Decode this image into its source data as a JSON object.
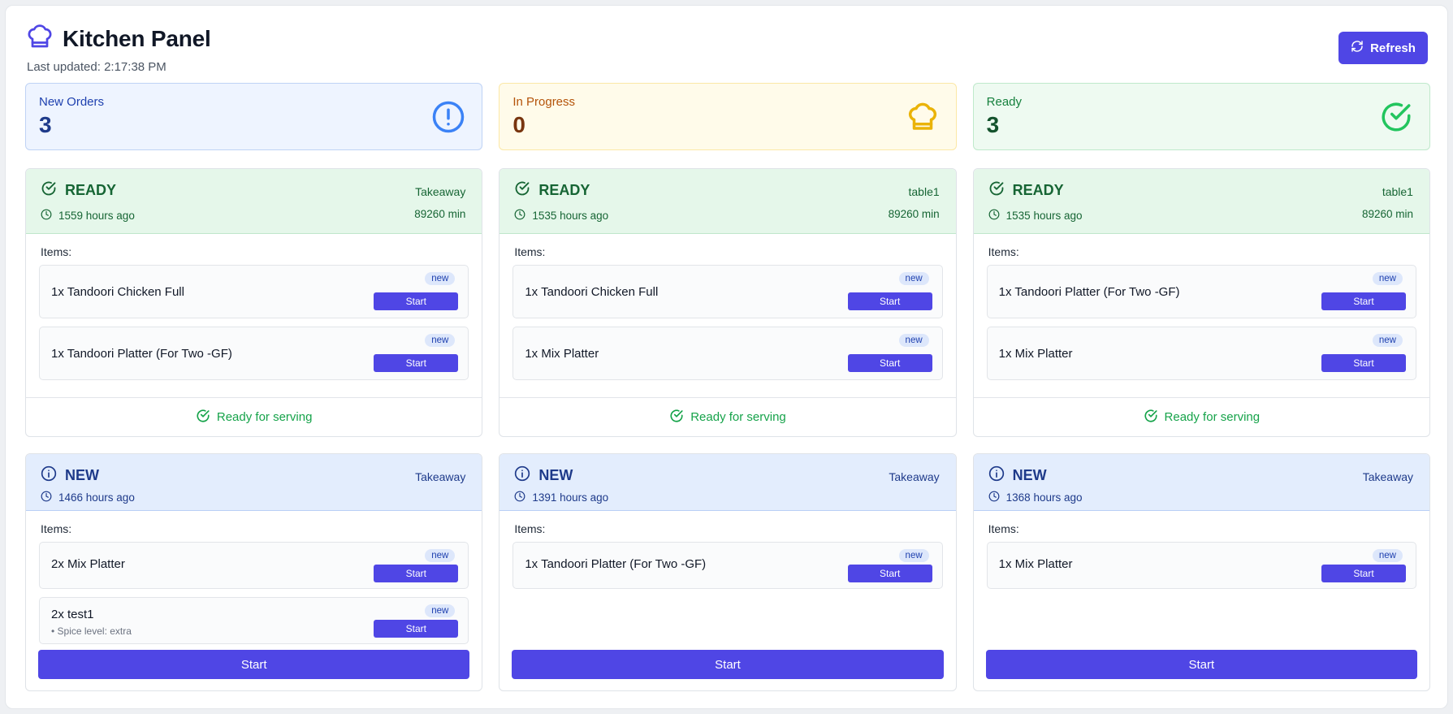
{
  "header": {
    "title": "Kitchen Panel",
    "last_updated": "Last updated: 2:17:38 PM",
    "refresh_label": "Refresh"
  },
  "stats": {
    "new": {
      "label": "New Orders",
      "value": "3"
    },
    "in_progress": {
      "label": "In Progress",
      "value": "0"
    },
    "ready": {
      "label": "Ready",
      "value": "3"
    }
  },
  "orders": [
    {
      "status": "READY",
      "table": "Takeaway",
      "age": "1559 hours ago",
      "minutes": "89260 min",
      "items_label": "Items:",
      "items": [
        {
          "name": "1x Tandoori Chicken Full",
          "badge": "new",
          "action": "Start"
        },
        {
          "name": "1x Tandoori Platter (For Two -GF)",
          "badge": "new",
          "action": "Start"
        }
      ],
      "footer": "Ready for serving"
    },
    {
      "status": "READY",
      "table": "table1",
      "age": "1535 hours ago",
      "minutes": "89260 min",
      "items_label": "Items:",
      "items": [
        {
          "name": "1x Tandoori Chicken Full",
          "badge": "new",
          "action": "Start"
        },
        {
          "name": "1x Mix Platter",
          "badge": "new",
          "action": "Start"
        }
      ],
      "footer": "Ready for serving"
    },
    {
      "status": "READY",
      "table": "table1",
      "age": "1535 hours ago",
      "minutes": "89260 min",
      "items_label": "Items:",
      "items": [
        {
          "name": "1x Tandoori Platter (For Two -GF)",
          "badge": "new",
          "action": "Start"
        },
        {
          "name": "1x Mix Platter",
          "badge": "new",
          "action": "Start"
        }
      ],
      "footer": "Ready for serving"
    },
    {
      "status": "NEW",
      "table": "Takeaway",
      "age": "1466 hours ago",
      "items_label": "Items:",
      "items": [
        {
          "name": "2x Mix Platter",
          "badge": "new",
          "action": "Start"
        },
        {
          "name": "2x test1",
          "note": "• Spice level: extra",
          "badge": "new",
          "action": "Start"
        }
      ],
      "footer_button": "Start"
    },
    {
      "status": "NEW",
      "table": "Takeaway",
      "age": "1391 hours ago",
      "items_label": "Items:",
      "items": [
        {
          "name": "1x Tandoori Platter (For Two -GF)",
          "badge": "new",
          "action": "Start"
        }
      ],
      "footer_button": "Start"
    },
    {
      "status": "NEW",
      "table": "Takeaway",
      "age": "1368 hours ago",
      "items_label": "Items:",
      "items": [
        {
          "name": "1x Mix Platter",
          "badge": "new",
          "action": "Start"
        }
      ],
      "footer_button": "Start"
    }
  ],
  "icons": {
    "logo": "chef-hat-icon",
    "refresh": "refresh-icon",
    "new_stat": "alert-circle-icon",
    "progress_stat": "chef-hat-icon",
    "ready_stat": "check-circle-icon",
    "ready_status": "check-circle-icon",
    "new_status": "info-icon",
    "time": "clock-icon"
  },
  "colors": {
    "accent": "#4f46e5",
    "ready": "#16a34a",
    "new": "#1e40af",
    "progress": "#eab308"
  }
}
